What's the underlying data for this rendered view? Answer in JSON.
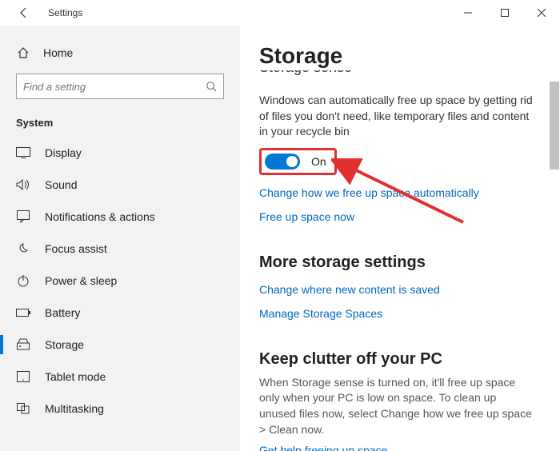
{
  "titlebar": {
    "title": "Settings"
  },
  "sidebar": {
    "home": "Home",
    "search_placeholder": "Find a setting",
    "category": "System",
    "items": [
      {
        "label": "Display"
      },
      {
        "label": "Sound"
      },
      {
        "label": "Notifications & actions"
      },
      {
        "label": "Focus assist"
      },
      {
        "label": "Power & sleep"
      },
      {
        "label": "Battery"
      },
      {
        "label": "Storage",
        "selected": true
      },
      {
        "label": "Tablet mode"
      },
      {
        "label": "Multitasking"
      }
    ]
  },
  "content": {
    "page_title": "Storage",
    "truncated_heading": "Storage sense",
    "storage_sense_desc": "Windows can automatically free up space by getting rid of files you don't need, like temporary files and content in your recycle bin",
    "toggle_state": "On",
    "link_change_auto": "Change how we free up space automatically",
    "link_free_now": "Free up space now",
    "more_heading": "More storage settings",
    "link_change_save": "Change where new content is saved",
    "link_manage_spaces": "Manage Storage Spaces",
    "clutter_heading": "Keep clutter off your PC",
    "clutter_desc": "When Storage sense is turned on, it'll free up space only when your PC is low on space. To clean up unused files now, select Change how we free up space > Clean now.",
    "link_help": "Get help freeing up space"
  }
}
